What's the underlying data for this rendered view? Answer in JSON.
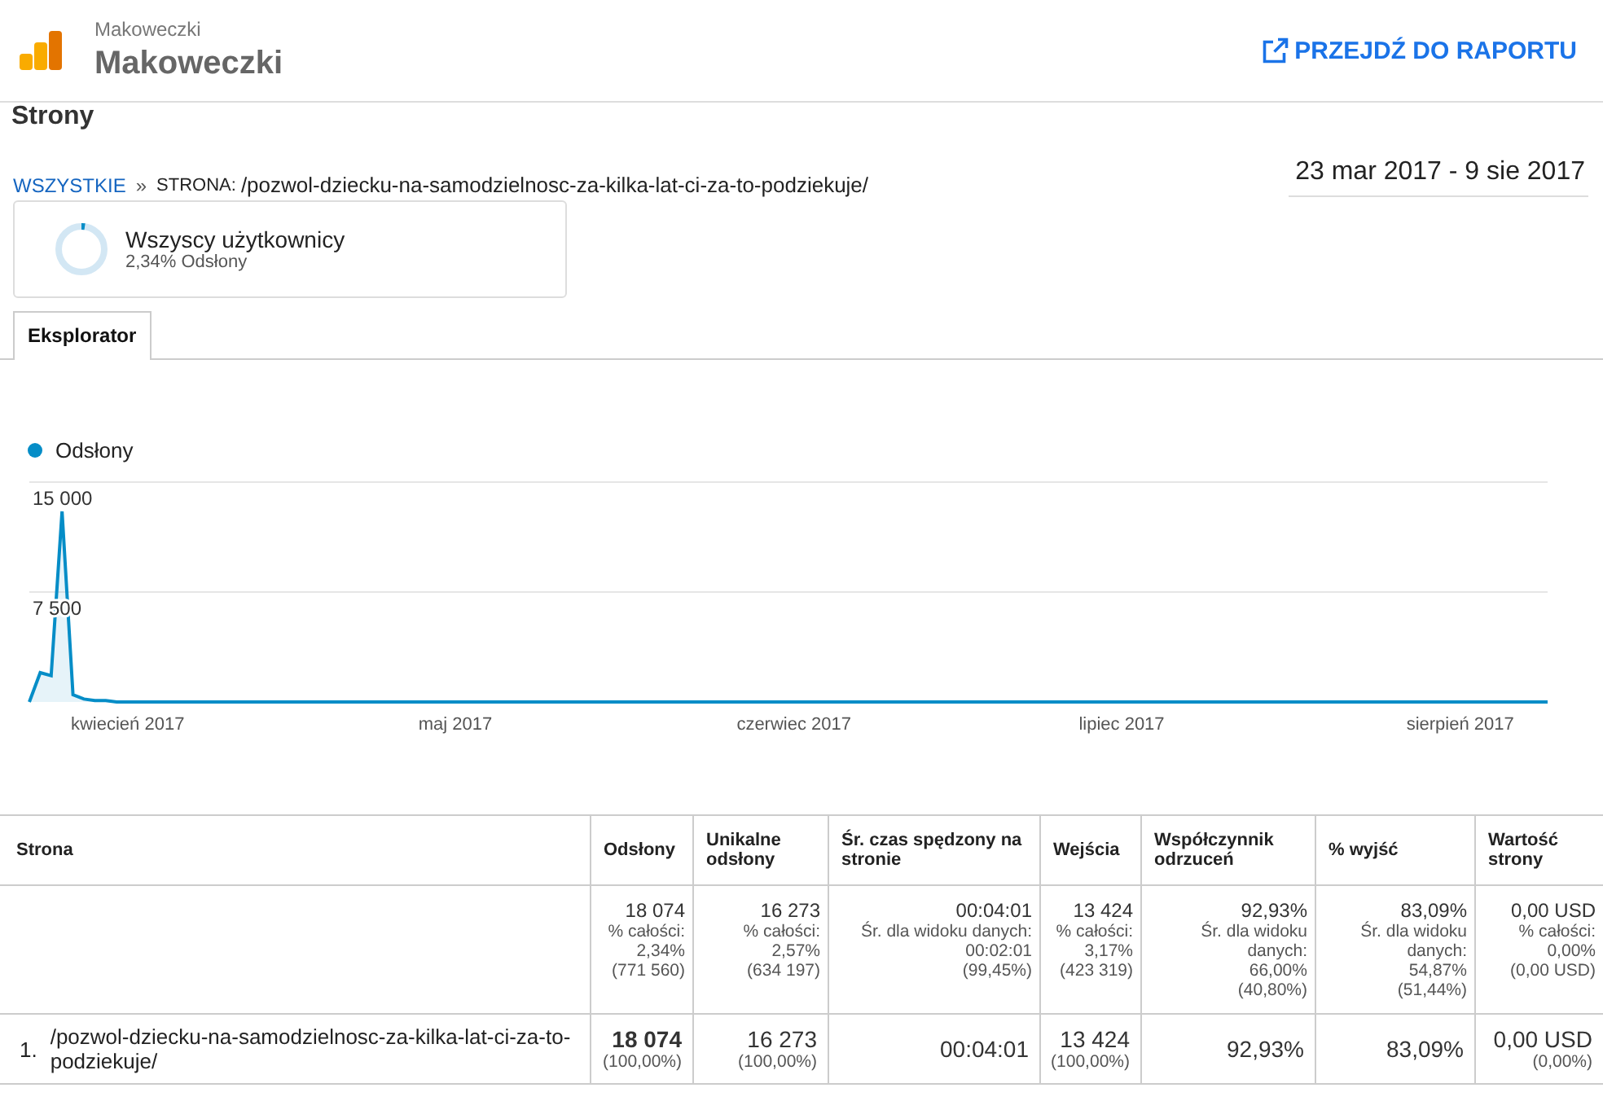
{
  "header": {
    "account": "Makoweczki",
    "property": "Makoweczki",
    "report_link": "PRZEJDŹ DO RAPORTU"
  },
  "page_title": "Strony",
  "breadcrumb": {
    "root": "WSZYSTKIE",
    "separator": "»",
    "label": "STRONA:",
    "value": "/pozwol-dziecku-na-samodzielnosc-za-kilka-lat-ci-za-to-podziekuje/"
  },
  "date_range": "23 mar 2017 - 9 sie 2017",
  "segment": {
    "name": "Wszyscy użytkownicy",
    "share": "2,34% Odsłony",
    "level": 0.0234
  },
  "tabs": [
    {
      "label": "Eksplorator",
      "selected": true
    }
  ],
  "chart": {
    "chart_data": {
      "type": "area",
      "series": [
        {
          "name": "Odsłony",
          "color": "#058dc7",
          "values": [
            0,
            2000,
            1800,
            13000,
            500,
            200,
            100,
            100,
            0,
            0,
            0,
            0,
            0,
            0,
            0,
            0,
            0,
            0,
            0,
            0,
            0,
            0,
            0,
            0,
            0,
            0,
            0,
            0,
            0,
            0,
            0,
            0,
            0,
            0,
            0,
            0,
            0,
            0,
            0,
            0,
            0,
            0,
            0,
            0,
            0,
            0,
            0,
            0,
            0,
            0,
            0,
            0,
            0,
            0,
            0,
            0,
            0,
            0,
            0,
            0,
            0,
            0,
            0,
            0,
            0,
            0,
            0,
            0,
            0,
            0,
            0,
            0,
            0,
            0,
            0,
            0,
            0,
            0,
            0,
            0,
            0,
            0,
            0,
            0,
            0,
            0,
            0,
            0,
            0,
            0,
            0,
            0,
            0,
            0,
            0,
            0,
            0,
            0,
            0,
            0,
            0,
            0,
            0,
            0,
            0,
            0,
            0,
            0,
            0,
            0,
            0,
            0,
            0,
            0,
            0,
            0,
            0,
            0,
            0,
            0,
            0,
            0,
            0,
            0,
            0,
            0,
            0,
            0,
            0,
            0,
            0,
            0,
            0,
            0,
            0,
            0,
            0,
            0,
            0,
            0
          ]
        }
      ],
      "ylim": [
        0,
        15000
      ],
      "yticks": [
        {
          "value": 7500,
          "label": "7 500"
        },
        {
          "value": 15000,
          "label": "15 000"
        }
      ],
      "categories": [
        null,
        null,
        null,
        null,
        null,
        null,
        null,
        null,
        null,
        "kwiecień 2017",
        null,
        null,
        null,
        null,
        null,
        null,
        null,
        null,
        null,
        null,
        null,
        null,
        null,
        null,
        null,
        null,
        null,
        null,
        null,
        null,
        null,
        null,
        null,
        null,
        null,
        null,
        null,
        null,
        null,
        "maj 2017",
        null,
        null,
        null,
        null,
        null,
        null,
        null,
        null,
        null,
        null,
        null,
        null,
        null,
        null,
        null,
        null,
        null,
        null,
        null,
        null,
        null,
        null,
        null,
        null,
        null,
        null,
        null,
        null,
        null,
        null,
        "czerwiec 2017",
        null,
        null,
        null,
        null,
        null,
        null,
        null,
        null,
        null,
        null,
        null,
        null,
        null,
        null,
        null,
        null,
        null,
        null,
        null,
        null,
        null,
        null,
        null,
        null,
        null,
        null,
        null,
        null,
        null,
        "lipiec 2017",
        null,
        null,
        null,
        null,
        null,
        null,
        null,
        null,
        null,
        null,
        null,
        null,
        null,
        null,
        null,
        null,
        null,
        null,
        null,
        null,
        null,
        null,
        null,
        null,
        null,
        null,
        null,
        null,
        null,
        null,
        "sierpień 2017",
        null,
        null,
        null,
        null,
        null,
        null,
        null,
        null
      ]
    }
  },
  "table": {
    "columns": [
      "Strona",
      "Odsłony",
      "Unikalne odsłony",
      "Śr. czas spędzony na stronie",
      "Wejścia",
      "Współczynnik odrzuceń",
      "% wyjść",
      "Wartość strony"
    ],
    "summary": [
      {
        "main": "18 074",
        "sub": [
          "% całości:",
          "2,34%",
          "(771 560)"
        ]
      },
      {
        "main": "16 273",
        "sub": [
          "% całości:",
          "2,57%",
          "(634 197)"
        ]
      },
      {
        "main": "00:04:01",
        "sub": [
          "Śr. dla widoku danych:",
          "00:02:01",
          "(99,45%)"
        ]
      },
      {
        "main": "13 424",
        "sub": [
          "% całości:",
          "3,17%",
          "(423 319)"
        ]
      },
      {
        "main": "92,93%",
        "sub": [
          "Śr. dla widoku danych:",
          "66,00%",
          "(40,80%)"
        ]
      },
      {
        "main": "83,09%",
        "sub": [
          "Śr. dla widoku danych:",
          "54,87%",
          "(51,44%)"
        ]
      },
      {
        "main": "0,00 USD",
        "sub": [
          "% całości:",
          "0,00%",
          "(0,00 USD)"
        ]
      }
    ],
    "rows": [
      {
        "cells": [
          {
            "kind": "page",
            "rank": "1.",
            "main": "/pozwol-dziecku-na-samodzielnosc-za-kilka-lat-ci-za-to-podziekuje/"
          },
          {
            "kind": "metric",
            "main": "18 074",
            "share": "(100,00%)",
            "bold": true
          },
          {
            "kind": "metric",
            "main": "16 273",
            "share": "(100,00%)",
            "bold": false
          },
          {
            "kind": "metric",
            "main": "00:04:01",
            "bold": false
          },
          {
            "kind": "metric",
            "main": "13 424",
            "share": "(100,00%)",
            "bold": false
          },
          {
            "kind": "metric",
            "main": "92,93%",
            "bold": false
          },
          {
            "kind": "metric",
            "main": "83,09%",
            "bold": false
          },
          {
            "kind": "metric",
            "main": "0,00 USD",
            "share": "(0,00%)",
            "bold": false
          }
        ]
      }
    ]
  }
}
